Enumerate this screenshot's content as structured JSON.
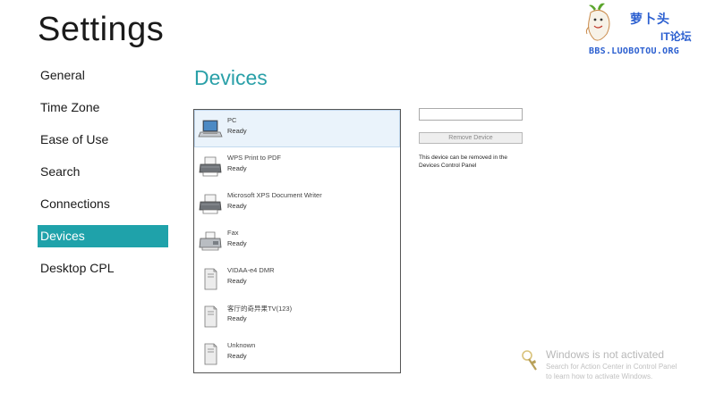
{
  "page": {
    "title": "Settings"
  },
  "nav": {
    "items": [
      {
        "label": "General"
      },
      {
        "label": "Time Zone"
      },
      {
        "label": "Ease of Use"
      },
      {
        "label": "Search"
      },
      {
        "label": "Connections"
      },
      {
        "label": "Devices"
      },
      {
        "label": "Desktop CPL"
      }
    ],
    "active": "Devices"
  },
  "devices": {
    "title": "Devices",
    "list": [
      {
        "name": "PC",
        "status": "Ready",
        "icon": "laptop-icon"
      },
      {
        "name": "WPS Print to PDF",
        "status": "Ready",
        "icon": "printer-icon"
      },
      {
        "name": "Microsoft XPS Document Writer",
        "status": "Ready",
        "icon": "printer-icon"
      },
      {
        "name": "Fax",
        "status": "Ready",
        "icon": "fax-icon"
      },
      {
        "name": "VIDAA-e4 DMR",
        "status": "Ready",
        "icon": "media-device-icon"
      },
      {
        "name": "客厅的奇异果TV(123)",
        "status": "Ready",
        "icon": "media-device-icon"
      },
      {
        "name": "Unknown",
        "status": "Ready",
        "icon": "media-device-icon"
      }
    ],
    "selected": "PC",
    "name_field_value": "",
    "remove_button": "Remove Device",
    "remove_note": "This device can be removed in the Devices Control Panel"
  },
  "logo": {
    "text_cn_1": "萝卜头",
    "text_cn_2": "IT论坛",
    "url": "BBS.LUOBOTOU.ORG",
    "color": "#2b5fd0"
  },
  "watermark": {
    "title": "Windows is not activated",
    "line1": "Search for Action Center in Control Panel",
    "line2": "to learn how to activate Windows.",
    "icon": "action-center-flag-icon"
  },
  "colors": {
    "accent": "#1fa2aa",
    "section_title": "#2aa0a8",
    "selection": "#eaf3fb"
  }
}
